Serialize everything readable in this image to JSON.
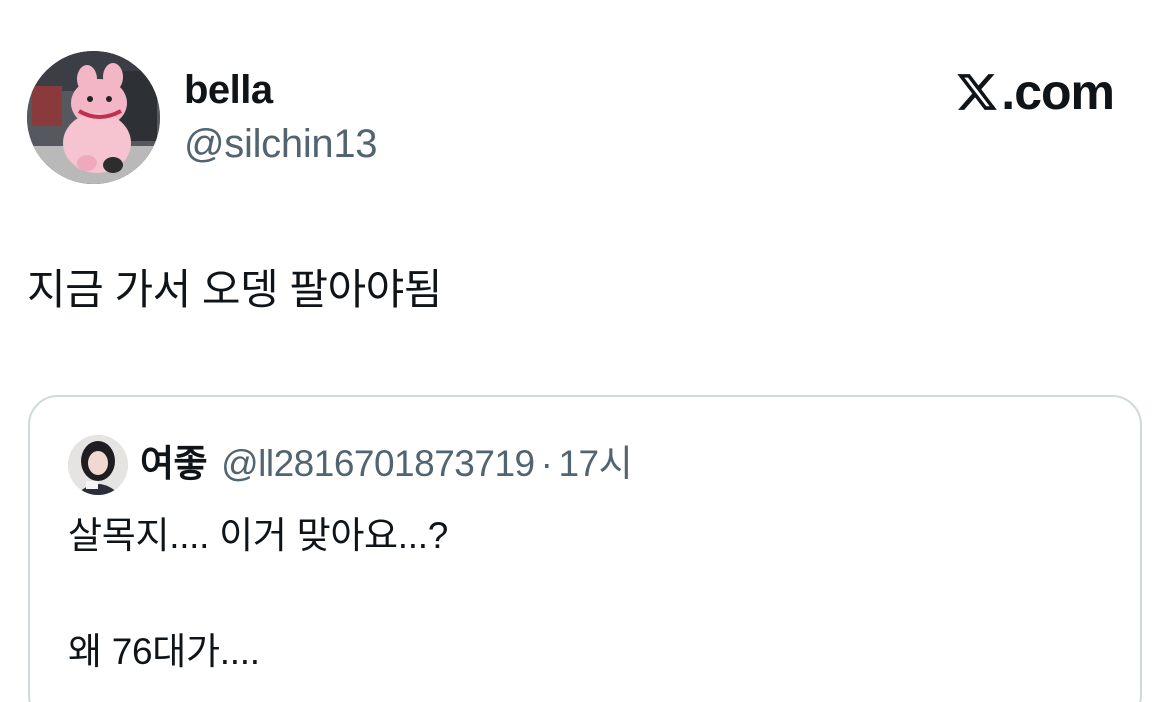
{
  "author": {
    "display_name": "bella",
    "handle": "@silchin13",
    "avatar_icon": "pink-plush-avatar"
  },
  "brand": {
    "label": "X.com",
    "logo_icon": "x-logo-icon"
  },
  "tweet": {
    "text": "지금 가서 오뎅 팔아야됨"
  },
  "quoted_tweet": {
    "display_name": "여좋",
    "handle": "@ll2816701873719",
    "separator": "·",
    "time": "17시",
    "avatar_icon": "person-avatar",
    "line1": "살목지.... 이거 맞아요...?",
    "line2": "왜 76대가...."
  },
  "colors": {
    "text_primary": "#0f1419",
    "text_secondary": "#536471",
    "border": "#cfd9de",
    "background": "#ffffff"
  }
}
